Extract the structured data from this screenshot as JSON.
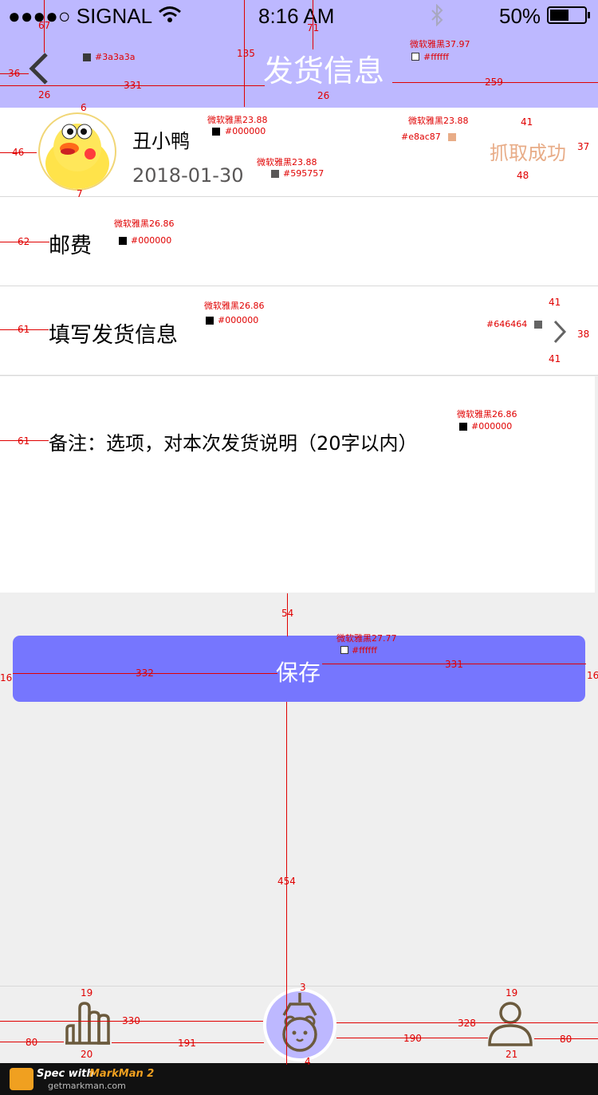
{
  "status_bar": {
    "signal": "●●●●○ SIGNAL",
    "time": "8:16 AM",
    "battery": "50%"
  },
  "header": {
    "title": "发货信息",
    "title_color": "#ffffff",
    "back_color": "#3a3a3a"
  },
  "user": {
    "name": "丑小鸭",
    "date": "2018-01-30",
    "status": "抓取成功",
    "status_color": "#e8ac87"
  },
  "rows": {
    "postage": "邮费",
    "fill_shipping": "填写发货信息",
    "note_placeholder": "备注：选项，对本次发货说明（20字以内）"
  },
  "save_button": {
    "label": "保存"
  },
  "annotations": {
    "font_3797": "微软雅黑37.97",
    "col_fff1": "#ffffff",
    "font_2388a": "微软雅黑23.88",
    "col_000a": "#000000",
    "font_2388b": "微软雅黑23.88",
    "col_595757": "#595757",
    "font_2388c": "微软雅黑23.88",
    "col_e8ac87": "#e8ac87",
    "font_2686a": "微软雅黑26.86",
    "col_000b": "#000000",
    "font_2686b": "微软雅黑26.86",
    "col_000c": "#000000",
    "col_646464": "#646464",
    "font_2686c": "微软雅黑26.86",
    "col_000d": "#000000",
    "font_2777": "微软雅黑27.77",
    "col_fff2": "#ffffff",
    "col_3a3a3a": "#3a3a3a",
    "n67": "67",
    "n36": "36",
    "n26a": "26",
    "n331a": "331",
    "n135": "135",
    "n71": "71",
    "n26b": "26",
    "n259": "259",
    "n6": "6",
    "n46": "46",
    "n7": "7",
    "n41a": "41",
    "n37": "37",
    "n48": "48",
    "n62": "62",
    "n41b": "41",
    "n61a": "61",
    "n38": "38",
    "n41c": "41",
    "n61b": "61",
    "n54": "54",
    "n16a": "16",
    "n332": "332",
    "n331b": "331",
    "n16b": "16",
    "n454": "454",
    "n19a": "19",
    "n330": "330",
    "n3": "3",
    "n19b": "19",
    "n328": "328",
    "n80a": "80",
    "n191": "191",
    "n190": "190",
    "n80b": "80",
    "n20": "20",
    "n4": "4",
    "n21": "21"
  },
  "footer": {
    "brand_prefix": "Spec with",
    "brand": "MarkMan 2",
    "site": "getmarkman.com"
  }
}
